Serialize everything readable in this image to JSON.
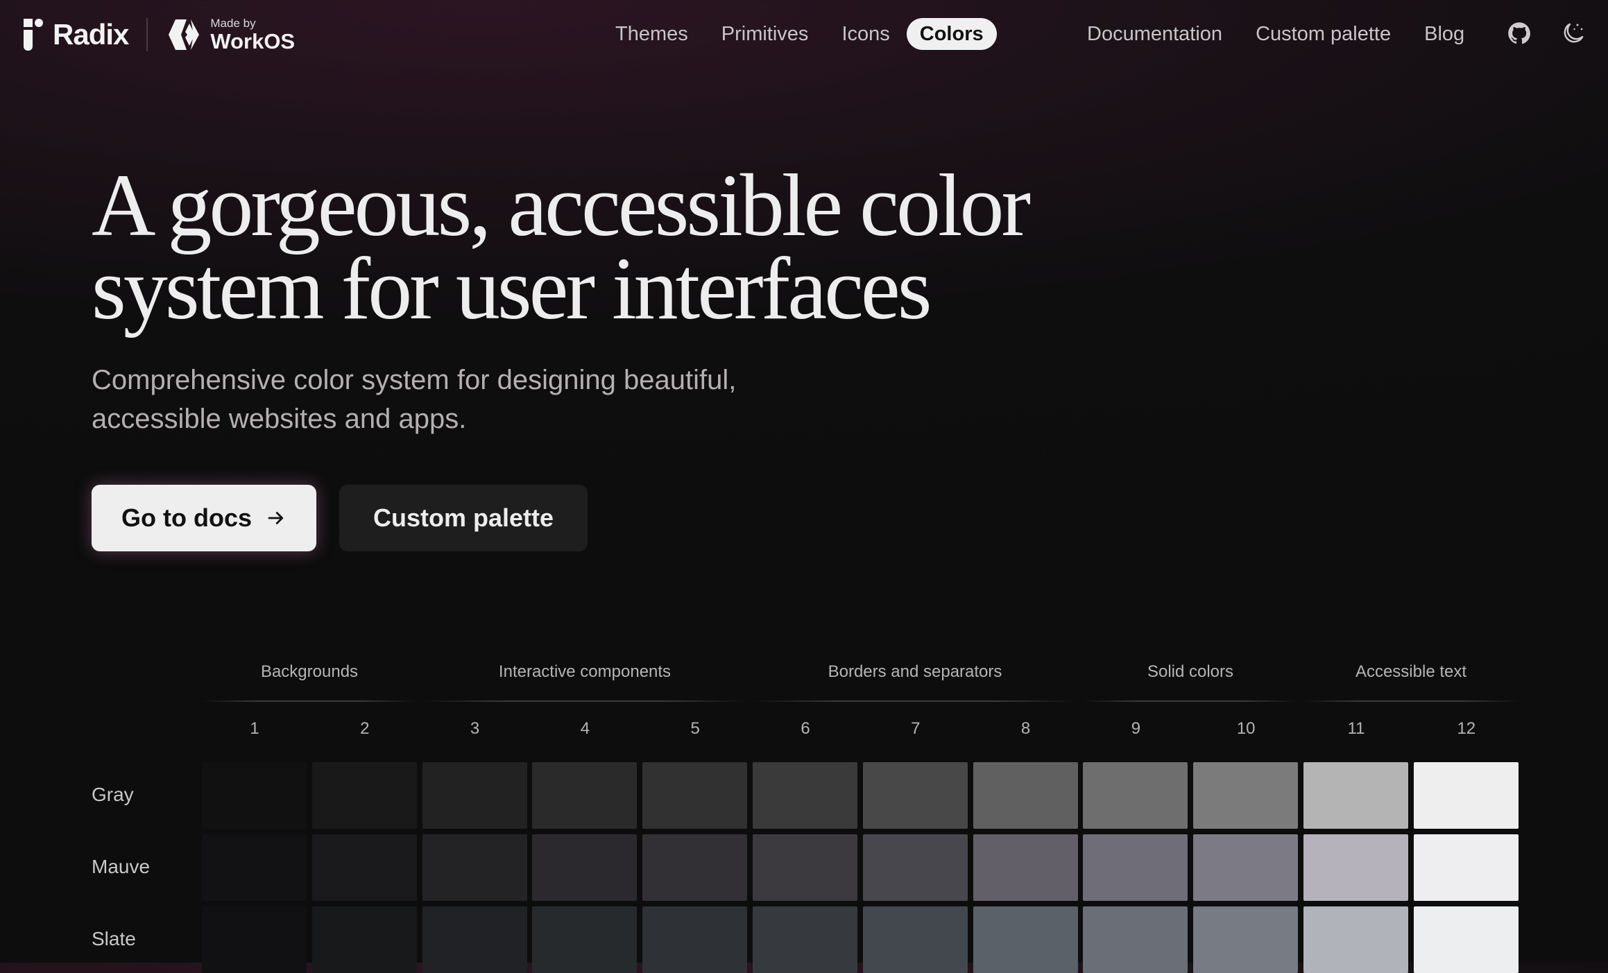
{
  "header": {
    "brand": "Radix",
    "made_by": "Made by",
    "workos": "WorkOS",
    "nav_left": [
      "Themes",
      "Primitives",
      "Icons",
      "Colors"
    ],
    "nav_active": "Colors",
    "nav_right": [
      "Documentation",
      "Custom palette",
      "Blog"
    ],
    "icons": [
      "github-icon",
      "theme-toggle-icon"
    ]
  },
  "hero": {
    "title": "A gorgeous, accessible color\nsystem for user interfaces",
    "subtitle": "Comprehensive color system for designing beautiful, accessible websites and apps.",
    "primary_button": "Go to docs",
    "secondary_button": "Custom palette"
  },
  "scale": {
    "groups": [
      "Backgrounds",
      "Interactive components",
      "Borders and separators",
      "Solid colors",
      "Accessible text"
    ],
    "steps": [
      "1",
      "2",
      "3",
      "4",
      "5",
      "6",
      "7",
      "8",
      "9",
      "10",
      "11",
      "12"
    ],
    "rows": [
      {
        "name": "Gray",
        "colors": [
          "#111111",
          "#191919",
          "#222222",
          "#2a2a2a",
          "#313131",
          "#3a3a3a",
          "#484848",
          "#606060",
          "#6e6e6e",
          "#7b7b7b",
          "#b4b4b4",
          "#eeeeee"
        ]
      },
      {
        "name": "Mauve",
        "colors": [
          "#121113",
          "#1a191b",
          "#232225",
          "#2b292d",
          "#323035",
          "#3c393f",
          "#49474e",
          "#625f69",
          "#6f6d78",
          "#7c7a85",
          "#b5b2bc",
          "#eeeef0"
        ]
      },
      {
        "name": "Slate",
        "colors": [
          "#111113",
          "#18191b",
          "#212225",
          "#272a2d",
          "#2e3135",
          "#363a3f",
          "#43484e",
          "#5a6169",
          "#696e77",
          "#777b84",
          "#b0b4ba",
          "#edeef0"
        ]
      }
    ]
  },
  "colors": {
    "accent_active_nav": "#f0f0f0",
    "primary_button_bg": "#eeeeee",
    "secondary_button_bg": "#1e1e1e"
  }
}
